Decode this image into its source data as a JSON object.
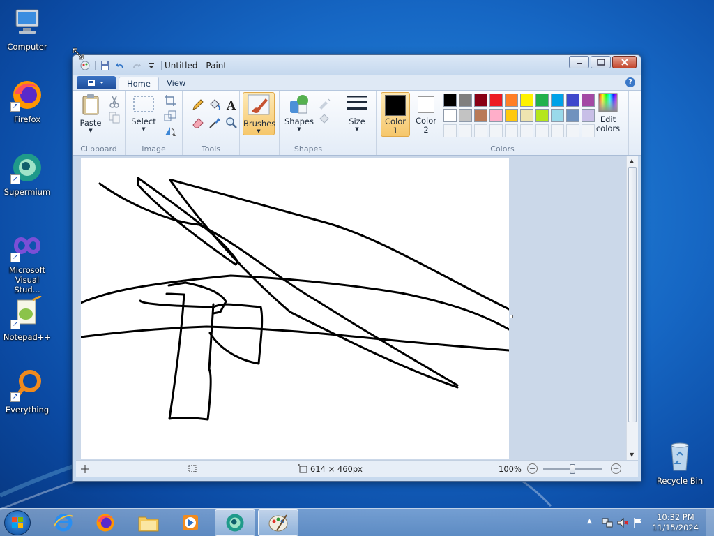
{
  "desktop": {
    "icons": [
      {
        "label": "Computer"
      },
      {
        "label": "Firefox"
      },
      {
        "label": "Supermium"
      },
      {
        "label": "Microsoft Visual Stud..."
      },
      {
        "label": "Notepad++"
      },
      {
        "label": "Everything"
      },
      {
        "label": "Recycle Bin"
      }
    ]
  },
  "window": {
    "title": "Untitled - Paint",
    "tabs": [
      {
        "label": "Home"
      },
      {
        "label": "View"
      }
    ],
    "help_icon": "?"
  },
  "ribbon": {
    "clipboard": {
      "group": "Clipboard",
      "paste": "Paste"
    },
    "image": {
      "group": "Image",
      "select": "Select"
    },
    "tools": {
      "group": "Tools"
    },
    "brushes": {
      "label": "Brushes"
    },
    "shapes": {
      "group": "Shapes",
      "label": "Shapes"
    },
    "size": {
      "label": "Size"
    },
    "colors": {
      "group": "Colors",
      "color1_line1": "Color",
      "color1_line2": "1",
      "color2_line1": "Color",
      "color2_line2": "2",
      "edit_line1": "Edit",
      "edit_line2": "colors",
      "color1_value": "#000000",
      "color2_value": "#ffffff",
      "palette_row1": [
        "#000000",
        "#7f7f7f",
        "#880015",
        "#ed1c24",
        "#ff7f27",
        "#fff200",
        "#22b14c",
        "#00a2e8",
        "#3f48cc",
        "#a349a4"
      ],
      "palette_row2": [
        "#ffffff",
        "#c3c3c3",
        "#b97a57",
        "#ffaec9",
        "#ffc90e",
        "#efe4b0",
        "#b5e61d",
        "#99d9ea",
        "#7092be",
        "#c8bfe7"
      ]
    }
  },
  "status": {
    "dimensions": "614 × 460px",
    "zoom": "100%",
    "zoom_level_percent": 100
  },
  "taskbar": {
    "clock_time": "10:32 PM",
    "clock_date": "11/15/2024"
  }
}
